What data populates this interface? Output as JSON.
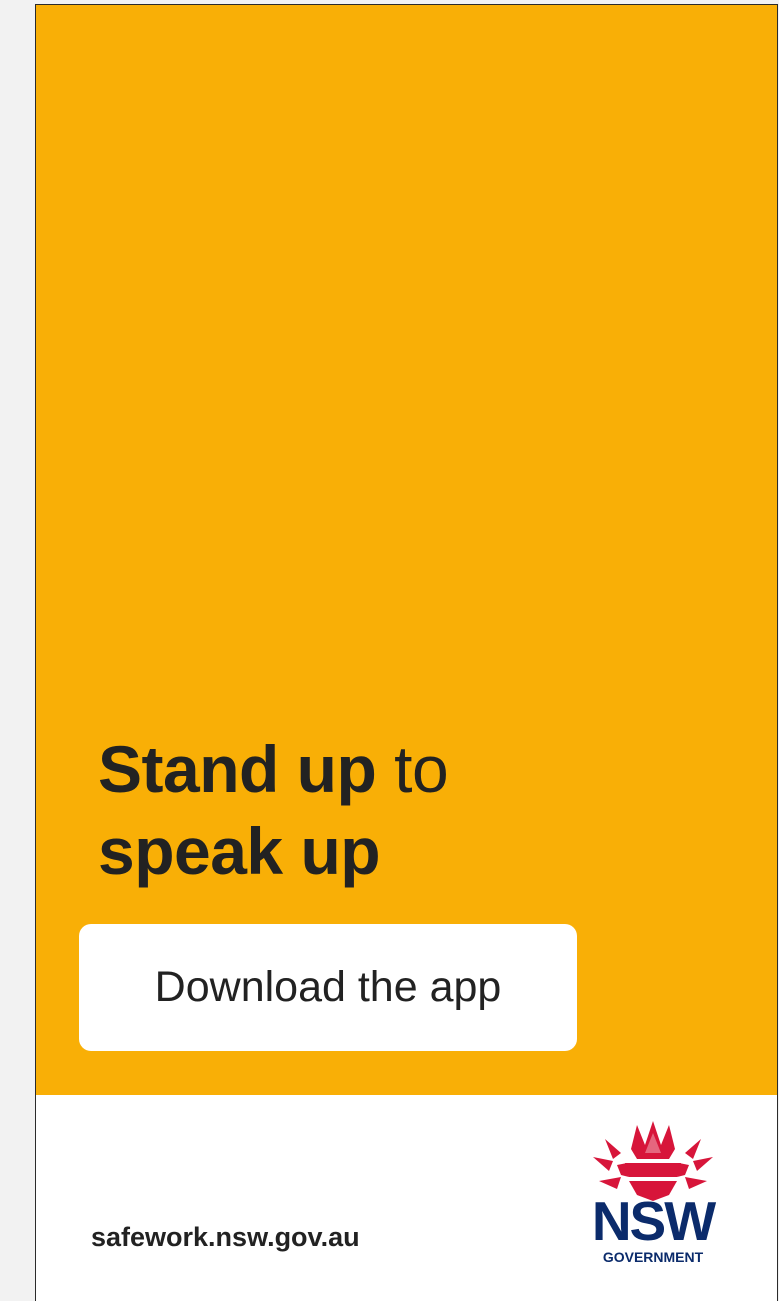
{
  "ad": {
    "headline_bold_1": "Stand up",
    "headline_light": "to",
    "headline_bold_2": "speak up",
    "cta_label": "Download the app"
  },
  "footer": {
    "url": "safework.nsw.gov.au",
    "logo_wordmark": "NSW",
    "logo_subtitle": "GOVERNMENT"
  },
  "colors": {
    "hero_background": "#f9af06",
    "text": "#222222",
    "logo_blue": "#0b2b6b",
    "logo_red": "#d7153a"
  },
  "icons": {
    "logo_mark": "waratah-flower-icon"
  }
}
